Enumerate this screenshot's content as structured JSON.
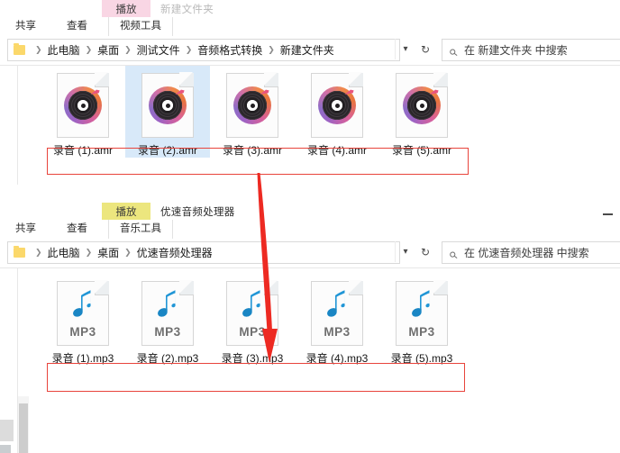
{
  "windows": [
    {
      "id": "amr-window",
      "context_title": "新建文件夹",
      "context_tab": "播放",
      "context_tab_color": "#f9d6e4",
      "tabs": [
        "共享",
        "查看",
        "视频工具"
      ],
      "active_tab": "视频工具",
      "address": {
        "folder_icon": "folder-icon",
        "crumbs": [
          "此电脑",
          "桌面",
          "测试文件",
          "音频格式转换",
          "新建文件夹"
        ],
        "caret_icon": "chevron-down-icon",
        "refresh_icon": "refresh-icon"
      },
      "search": {
        "icon": "search-icon",
        "placeholder": "在 新建文件夹 中搜索"
      },
      "files": [
        {
          "name": "录音 (1).amr",
          "icon": "vinyl-record-icon",
          "selected": false
        },
        {
          "name": "录音 (2).amr",
          "icon": "vinyl-record-icon",
          "selected": true
        },
        {
          "name": "录音 (3).amr",
          "icon": "vinyl-record-icon",
          "selected": false
        },
        {
          "name": "录音 (4).amr",
          "icon": "vinyl-record-icon",
          "selected": false
        },
        {
          "name": "录音 (5).amr",
          "icon": "vinyl-record-icon",
          "selected": false
        }
      ]
    },
    {
      "id": "mp3-window",
      "context_title": "优速音频处理器",
      "context_tab": "播放",
      "context_tab_color": "#ece67e",
      "tabs": [
        "共享",
        "查看",
        "音乐工具"
      ],
      "active_tab": "音乐工具",
      "address": {
        "folder_icon": "folder-icon",
        "crumbs": [
          "此电脑",
          "桌面",
          "优速音频处理器"
        ],
        "caret_icon": "chevron-down-icon",
        "refresh_icon": "refresh-icon"
      },
      "search": {
        "icon": "search-icon",
        "placeholder": "在 优速音频处理器 中搜索"
      },
      "files": [
        {
          "name": "录音 (1).mp3",
          "icon": "mp3-note-icon",
          "badge": "MP3",
          "selected": false
        },
        {
          "name": "录音 (2).mp3",
          "icon": "mp3-note-icon",
          "badge": "MP3",
          "selected": false
        },
        {
          "name": "录音 (3).mp3",
          "icon": "mp3-note-icon",
          "badge": "MP3",
          "selected": false
        },
        {
          "name": "录音 (4).mp3",
          "icon": "mp3-note-icon",
          "badge": "MP3",
          "selected": false
        },
        {
          "name": "录音 (5).mp3",
          "icon": "mp3-note-icon",
          "badge": "MP3",
          "selected": false
        }
      ]
    }
  ],
  "annotations": {
    "highlight_color": "#e8443c",
    "arrow_color": "#ed2a22",
    "arrow_label": "conversion-arrow"
  },
  "colors": {
    "selection": "#d8e9f9",
    "pink_tab": "#f9d6e4",
    "yellow_tab": "#ece67e",
    "mp3_note": "#2196d6",
    "folder": "#fbd86b"
  }
}
